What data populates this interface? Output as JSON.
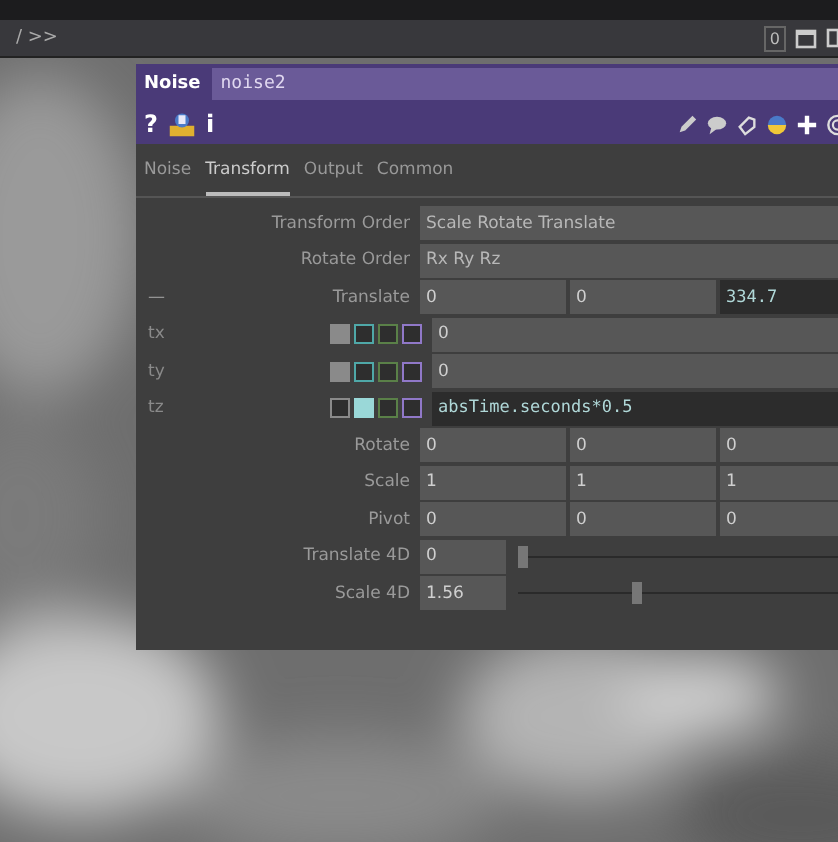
{
  "path_bar": {
    "path": "/ >>",
    "counter": "0"
  },
  "panel": {
    "type": "Noise",
    "name": "noise2",
    "help": "?",
    "info": "i",
    "tabs": [
      {
        "label": "Noise",
        "selected": false
      },
      {
        "label": "Transform",
        "selected": true
      },
      {
        "label": "Output",
        "selected": false
      },
      {
        "label": "Common",
        "selected": false
      }
    ],
    "params": [
      {
        "kind": "menu",
        "label": "Transform Order",
        "value": "Scale Rotate Translate"
      },
      {
        "kind": "menu",
        "label": "Rotate Order",
        "value": "Rx Ry Rz"
      },
      {
        "kind": "vector",
        "label": "Translate",
        "tag": "—",
        "values": [
          {
            "text": "0",
            "expression": false
          },
          {
            "text": "0",
            "expression": false
          },
          {
            "text": "334.7",
            "expression": true
          }
        ]
      },
      {
        "kind": "component",
        "label": "tx",
        "value": "0",
        "expression": false,
        "modes": [
          {
            "color": "#8a8a8a",
            "selected": true
          },
          {
            "color": "#4fa8a8",
            "selected": false
          },
          {
            "color": "#5a8048",
            "selected": false
          },
          {
            "color": "#9078c8",
            "selected": false
          }
        ]
      },
      {
        "kind": "component",
        "label": "ty",
        "value": "0",
        "expression": false,
        "modes": [
          {
            "color": "#8a8a8a",
            "selected": true
          },
          {
            "color": "#4fa8a8",
            "selected": false
          },
          {
            "color": "#5a8048",
            "selected": false
          },
          {
            "color": "#9078c8",
            "selected": false
          }
        ]
      },
      {
        "kind": "component",
        "label": "tz",
        "value": "absTime.seconds*0.5",
        "expression": true,
        "modes": [
          {
            "color": "#8a8a8a",
            "selected": false
          },
          {
            "color": "#9ad8d8",
            "selected": true
          },
          {
            "color": "#5a8048",
            "selected": false
          },
          {
            "color": "#9078c8",
            "selected": false
          }
        ]
      },
      {
        "kind": "vector",
        "label": "Rotate",
        "values": [
          {
            "text": "0",
            "expression": false
          },
          {
            "text": "0",
            "expression": false
          },
          {
            "text": "0",
            "expression": false
          }
        ]
      },
      {
        "kind": "vector",
        "label": "Scale",
        "values": [
          {
            "text": "1",
            "expression": false
          },
          {
            "text": "1",
            "expression": false
          },
          {
            "text": "1",
            "expression": false
          }
        ]
      },
      {
        "kind": "vector",
        "label": "Pivot",
        "values": [
          {
            "text": "0",
            "expression": false
          },
          {
            "text": "0",
            "expression": false
          },
          {
            "text": "0",
            "expression": false
          }
        ]
      },
      {
        "kind": "slider",
        "label": "Translate 4D",
        "value": "0",
        "level": 0
      },
      {
        "kind": "slider",
        "label": "Scale 4D",
        "value": "1.56",
        "level": 0.39
      }
    ]
  }
}
